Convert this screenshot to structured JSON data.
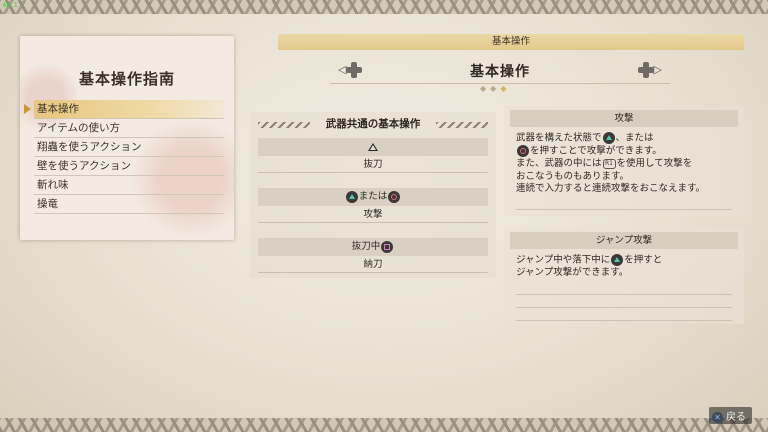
{
  "overlay": {
    "fps": "60.1"
  },
  "guide": {
    "title": "基本操作指南",
    "menu": [
      {
        "label": "基本操作",
        "selected": true
      },
      {
        "label": "アイテムの使い方"
      },
      {
        "label": "翔蟲を使うアクション"
      },
      {
        "label": "壁を使うアクション"
      },
      {
        "label": "斬れ味"
      },
      {
        "label": "操竜"
      }
    ]
  },
  "header": {
    "category": "基本操作",
    "page_title": "基本操作"
  },
  "section": {
    "title": "武器共通の基本操作",
    "commands": [
      {
        "input": "",
        "action": "抜刀"
      },
      {
        "input_mid": "または",
        "action": "攻撃"
      },
      {
        "input_prefix": "抜刀中",
        "action": "納刀"
      }
    ]
  },
  "info": [
    {
      "title": "攻撃",
      "line1_a": "武器を構えた状態で",
      "line1_b": "、または",
      "line2": "を押すことで攻撃ができます。",
      "line3_a": "また、武器の中には",
      "line3_r1": "R1",
      "line3_b": "を使用して攻撃を",
      "line4": "おこなうものもあります。",
      "line5": "連続で入力すると連続攻撃をおこなえます。"
    },
    {
      "title": "ジャンプ攻撃",
      "line1_a": "ジャンプ中や落下中に",
      "line1_b": "を押すと",
      "line2": "ジャンプ攻撃ができます。"
    }
  ],
  "footer": {
    "back_label": "戻る"
  },
  "colors": {
    "accent_gold": "#e7c680",
    "triangle": "#4fc7a8",
    "circle": "#e36a7a",
    "square": "#d27fc5"
  }
}
